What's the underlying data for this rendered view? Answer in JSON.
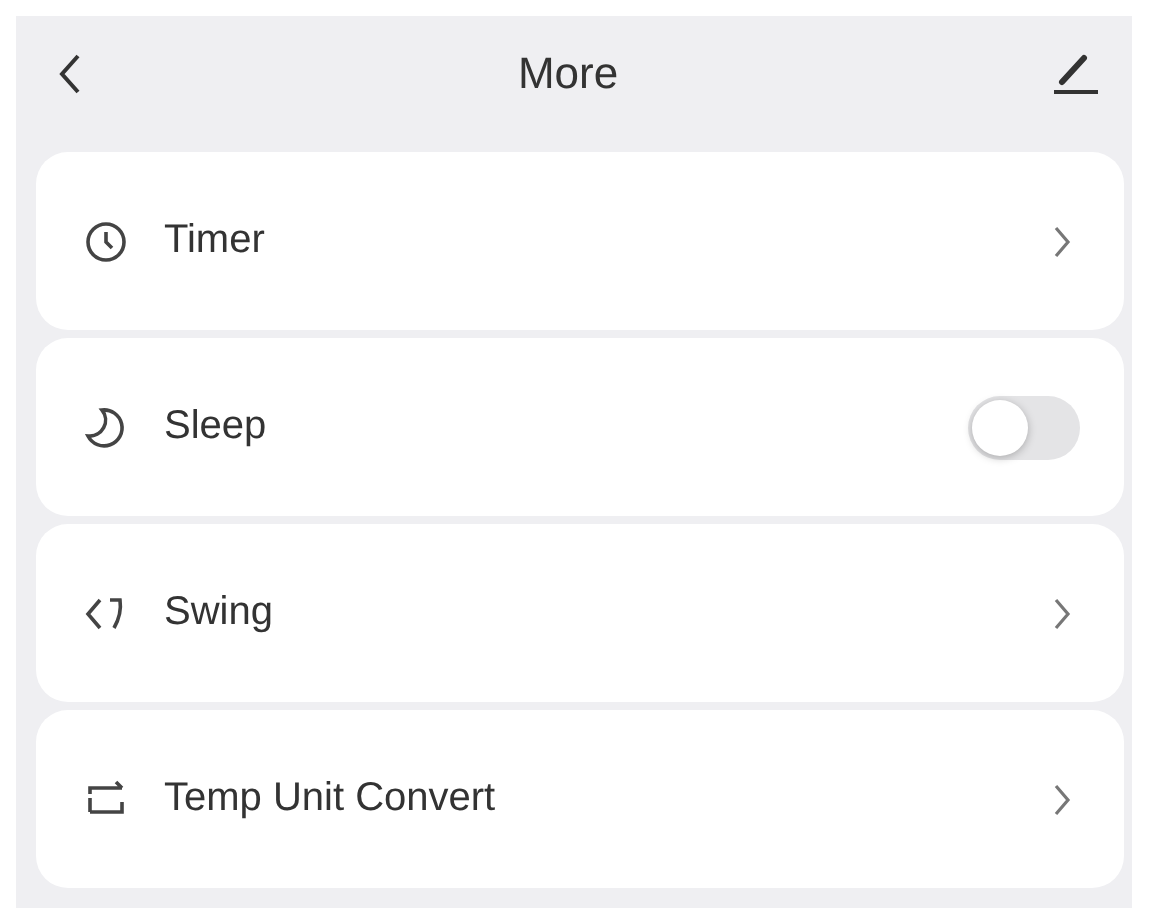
{
  "header": {
    "title": "More"
  },
  "rows": [
    {
      "label": "Timer",
      "kind": "link"
    },
    {
      "label": "Sleep",
      "kind": "toggle",
      "on": false
    },
    {
      "label": "Swing",
      "kind": "link"
    },
    {
      "label": "Temp Unit Convert",
      "kind": "link"
    }
  ]
}
